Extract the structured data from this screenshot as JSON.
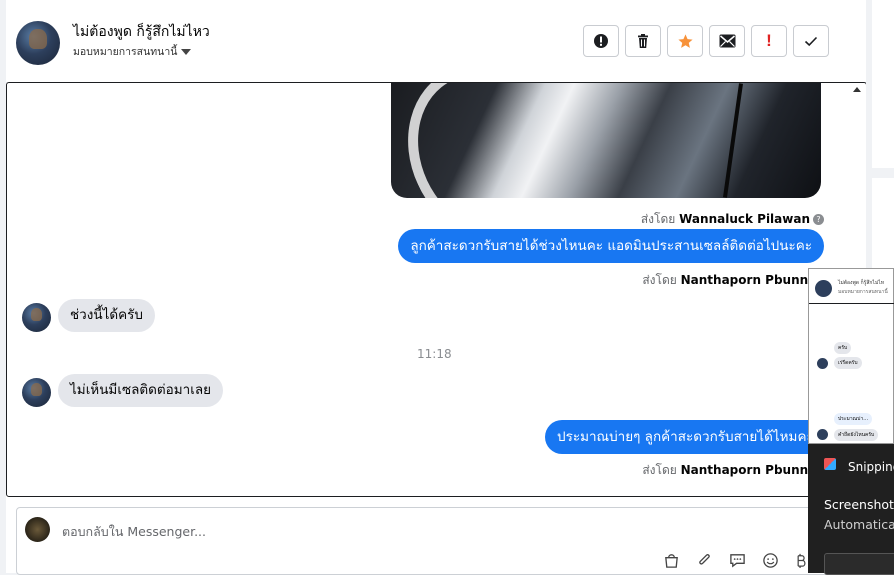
{
  "header": {
    "contact_name": "ไม่ต้องพูด ก็รู้สึกไม่ไหว",
    "assign_label": "มอบหมายการสนทนานี้",
    "actions": [
      {
        "name": "spam-icon"
      },
      {
        "name": "trash-icon"
      },
      {
        "name": "star-icon"
      },
      {
        "name": "mail-icon"
      },
      {
        "name": "important-icon",
        "text": "!"
      },
      {
        "name": "check-icon"
      }
    ],
    "colors": {
      "star": "#f7923a",
      "important": "#e02424"
    }
  },
  "conversation": {
    "sent_by_prefix": "ส่งโดย",
    "sent_by_1": "Wannaluck Pilawan",
    "msg_out_1": "ลูกค้าสะดวกรับสายได้ช่วงไหนคะ แอดมินประสานเซลล์ติดต่อไปนะคะ",
    "sent_by_2": "Nanthaporn Pbunny",
    "msg_in_1": "ช่วงนี้ได้ครับ",
    "timestamp": "11:18",
    "msg_in_2": "ไม่เห็นมีเซลติดต่อมาเลย",
    "msg_out_2": "ประมาณบ่ายๆ ลูกค้าสะดวกรับสายได้ไหมคะ",
    "sent_by_3": "Nanthaporn Pbunny"
  },
  "composer": {
    "placeholder": "ตอบกลับใน Messenger..."
  },
  "notification": {
    "app": "Snipping",
    "line1": "Screenshot",
    "line2": "Automatica",
    "preview": {
      "name": "ไม่ต้องพูด ก็รู้สึกไม่ไห",
      "sub": "มอบหมายการสนทนานี้",
      "b1": "ครับ",
      "b2": "เร่รีดครับ",
      "b3": "ประมาณบ่า...",
      "b4": "คำถึดยังไหนครับ"
    }
  },
  "accent": "#1877f2"
}
